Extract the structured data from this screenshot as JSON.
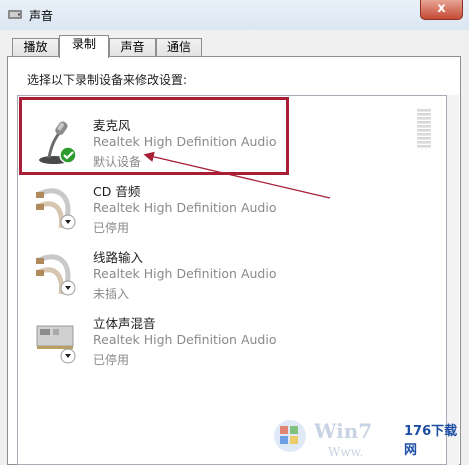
{
  "window": {
    "title": "声音",
    "close_label": "x"
  },
  "tabs": [
    {
      "label": "播放",
      "active": false
    },
    {
      "label": "录制",
      "active": true
    },
    {
      "label": "声音",
      "active": false
    },
    {
      "label": "通信",
      "active": false
    }
  ],
  "instruction": "选择以下录制设备来修改设置:",
  "devices": [
    {
      "name": "麦克风",
      "driver": "Realtek High Definition Audio",
      "status": "默认设备",
      "icon": "microphone-icon",
      "default": true
    },
    {
      "name": "CD 音频",
      "driver": "Realtek High Definition Audio",
      "status": "已停用",
      "icon": "audio-cable-icon",
      "default": false
    },
    {
      "name": "线路输入",
      "driver": "Realtek High Definition Audio",
      "status": "未插入",
      "icon": "audio-cable-icon",
      "default": false
    },
    {
      "name": "立体声混音",
      "driver": "Realtek High Definition Audio",
      "status": "已停用",
      "icon": "sound-card-icon",
      "default": false
    }
  ],
  "watermark": {
    "brand": "176下载网",
    "text": "Win7",
    "sub": "Www."
  },
  "colors": {
    "highlight": "#a81f35",
    "arrow": "#a81f35",
    "accent": "#1c4ea5"
  }
}
